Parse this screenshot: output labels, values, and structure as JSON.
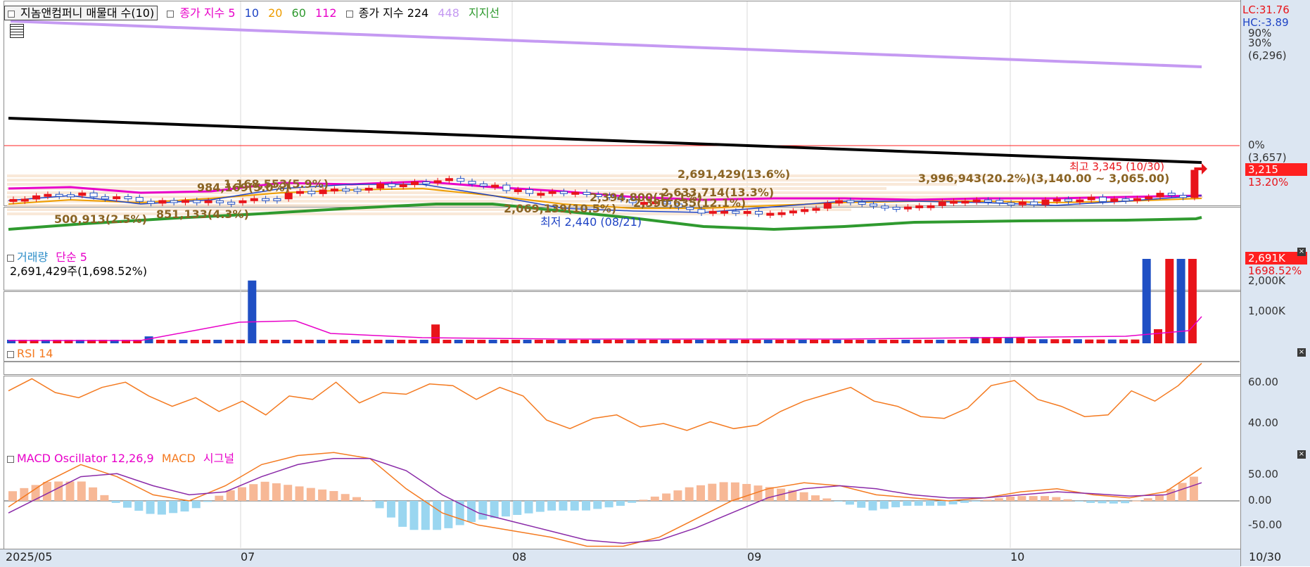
{
  "price_panel": {
    "legend": {
      "stock": "지놈앤컴퍼니 매물대 수(10)",
      "ma_title": "종가 지수 5",
      "ma10": "10",
      "ma20": "20",
      "ma60": "60",
      "ma112": "112",
      "ma224_title": "종가 지수 224",
      "ma448": "448",
      "support": "지지선"
    },
    "lc": "LC:31.76",
    "hc": "HC:-3.89",
    "y_ticks": [
      "90%",
      "30%",
      "(6,296)",
      "0%",
      "(3,657)"
    ],
    "current_price": "3,215",
    "current_pct": "13.20%",
    "annotations": {
      "high": "최고 3,345 (10/30)",
      "low": "최저 2,440 (08/21)",
      "vol_day": "2,691,429(13.6%)",
      "big_vol": "3,996,943(20.2%)(3,140.00 ~ 3,065.00)",
      "a1": "984,169(5.0%)",
      "a2": "1,168,553(5.9%)",
      "a3": "500,913(2.5%)",
      "a4": "851,133(4.3%)",
      "a5": "2,633,714(13.3%)",
      "a6": "2,394,800(12.1%)",
      "a7": "2,390,635(12.1%)",
      "a8": "2,069,139(10.5%)"
    }
  },
  "volume_panel": {
    "title": "거래량",
    "ma": "단순 5",
    "value": "2,691,429주(1,698.52%)",
    "label": "2,691K",
    "label_pct": "1698.52%",
    "y_ticks": [
      "2,000K",
      "1,000K"
    ]
  },
  "rsi_panel": {
    "title": "RSI 14",
    "y_ticks": [
      "60.00",
      "40.00"
    ]
  },
  "macd_panel": {
    "title_osc": "MACD Oscillator 12,26,9",
    "title_macd": "MACD",
    "title_signal": "시그널",
    "y_ticks": [
      "50.00",
      "0.00",
      "-50.00"
    ]
  },
  "x_axis": {
    "labels": [
      "2025/05",
      "07",
      "08",
      "09",
      "10"
    ],
    "last": "10/30"
  },
  "colors": {
    "up": "#e8141a",
    "down": "#1f4fc4",
    "ma5": "#e800c9",
    "ma10": "#1f44c5",
    "ma20": "#ee9d00",
    "ma60": "#2f9a2f",
    "ma112": "#e800c9",
    "ma224": "#000000",
    "ma448": "#c59af2",
    "rsi": "#f47a20",
    "macd_osc_pos": "#f7b896",
    "macd_osc_neg": "#9ad6f0"
  },
  "chart_data": [
    {
      "type": "line",
      "title": "지놈앤컴퍼니 매물대 수(10)",
      "series": [
        {
          "name": "448",
          "values": [
            6450,
            6296
          ]
        },
        {
          "name": "종가 지수 224",
          "values": [
            3880,
            3657
          ]
        }
      ],
      "annotations": [
        "최고 3,345 (10/30)",
        "최저 2,440 (08/21)"
      ]
    },
    {
      "type": "bar",
      "title": "거래량",
      "values": [
        0.09,
        0.11,
        0.06,
        0.06,
        0.06,
        0.09,
        0.06,
        0.06,
        0.06,
        0.06,
        0.06,
        0.06,
        0.05,
        0.05,
        0.06,
        0.08,
        0.2,
        0.13,
        0.12,
        2.69
      ]
    },
    {
      "type": "line",
      "title": "RSI 14",
      "ylim": [
        30,
        75
      ],
      "values": [
        58,
        65,
        57,
        54,
        60,
        63,
        55,
        49,
        54,
        46,
        52,
        44,
        55,
        53,
        63,
        51,
        57,
        56,
        62,
        61,
        53,
        60,
        55,
        41,
        36,
        42,
        44,
        37,
        39,
        35,
        40,
        36,
        38,
        46,
        52,
        56,
        60,
        52,
        49,
        43,
        42,
        48,
        61,
        64,
        53,
        49,
        43,
        44,
        58,
        52,
        61,
        74
      ]
    },
    {
      "type": "line",
      "title": "MACD Oscillator 12,26,9",
      "ylim": [
        -80,
        80
      ],
      "series": [
        {
          "name": "MACD",
          "values": [
            -10,
            30,
            60,
            40,
            10,
            0,
            25,
            60,
            75,
            80,
            70,
            20,
            -20,
            -40,
            -50,
            -60,
            -75,
            -75,
            -60,
            -30,
            0,
            20,
            30,
            25,
            10,
            5,
            0,
            5,
            15,
            20,
            10,
            5,
            15,
            55
          ]
        },
        {
          "name": "시그널",
          "values": [
            -20,
            10,
            40,
            45,
            25,
            10,
            15,
            40,
            60,
            70,
            70,
            50,
            10,
            -20,
            -35,
            -50,
            -65,
            -70,
            -65,
            -45,
            -20,
            5,
            20,
            25,
            20,
            10,
            5,
            5,
            10,
            15,
            12,
            8,
            10,
            30
          ]
        }
      ]
    }
  ]
}
